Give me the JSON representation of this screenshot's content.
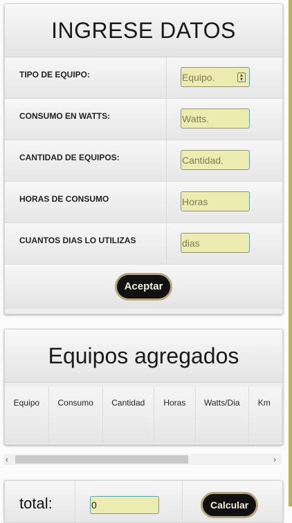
{
  "form": {
    "title": "INGRESE DATOS",
    "fields": [
      {
        "label": "TIPO DE EQUIPO:",
        "placeholder": "Equipo."
      },
      {
        "label": "CONSUMO EN WATTS:",
        "placeholder": "Watts."
      },
      {
        "label": "CANTIDAD DE EQUIPOS:",
        "placeholder": "Cantidad."
      },
      {
        "label": "HORAS DE CONSUMO",
        "placeholder": "Horas"
      },
      {
        "label": "CUANTOS DIAS LO UTILIZAS",
        "placeholder": "dias"
      }
    ],
    "accept_label": "Aceptar"
  },
  "table": {
    "title": "Equipos agregados",
    "columns": [
      "Equipo",
      "Consumo",
      "Cantidad",
      "Horas",
      "Watts/Dia",
      "Km"
    ]
  },
  "scroll": {
    "left_icon": "chevron-left-icon",
    "right_icon": "chevron-right-icon"
  },
  "summary": {
    "total_label": "total:",
    "total_value": "0",
    "calc_label": "Calcular"
  },
  "colors": {
    "accent_border": "#5aa5b5",
    "input_bg": "#ecebb0",
    "button_bg": "#111111",
    "edge": "#b9b54a"
  }
}
